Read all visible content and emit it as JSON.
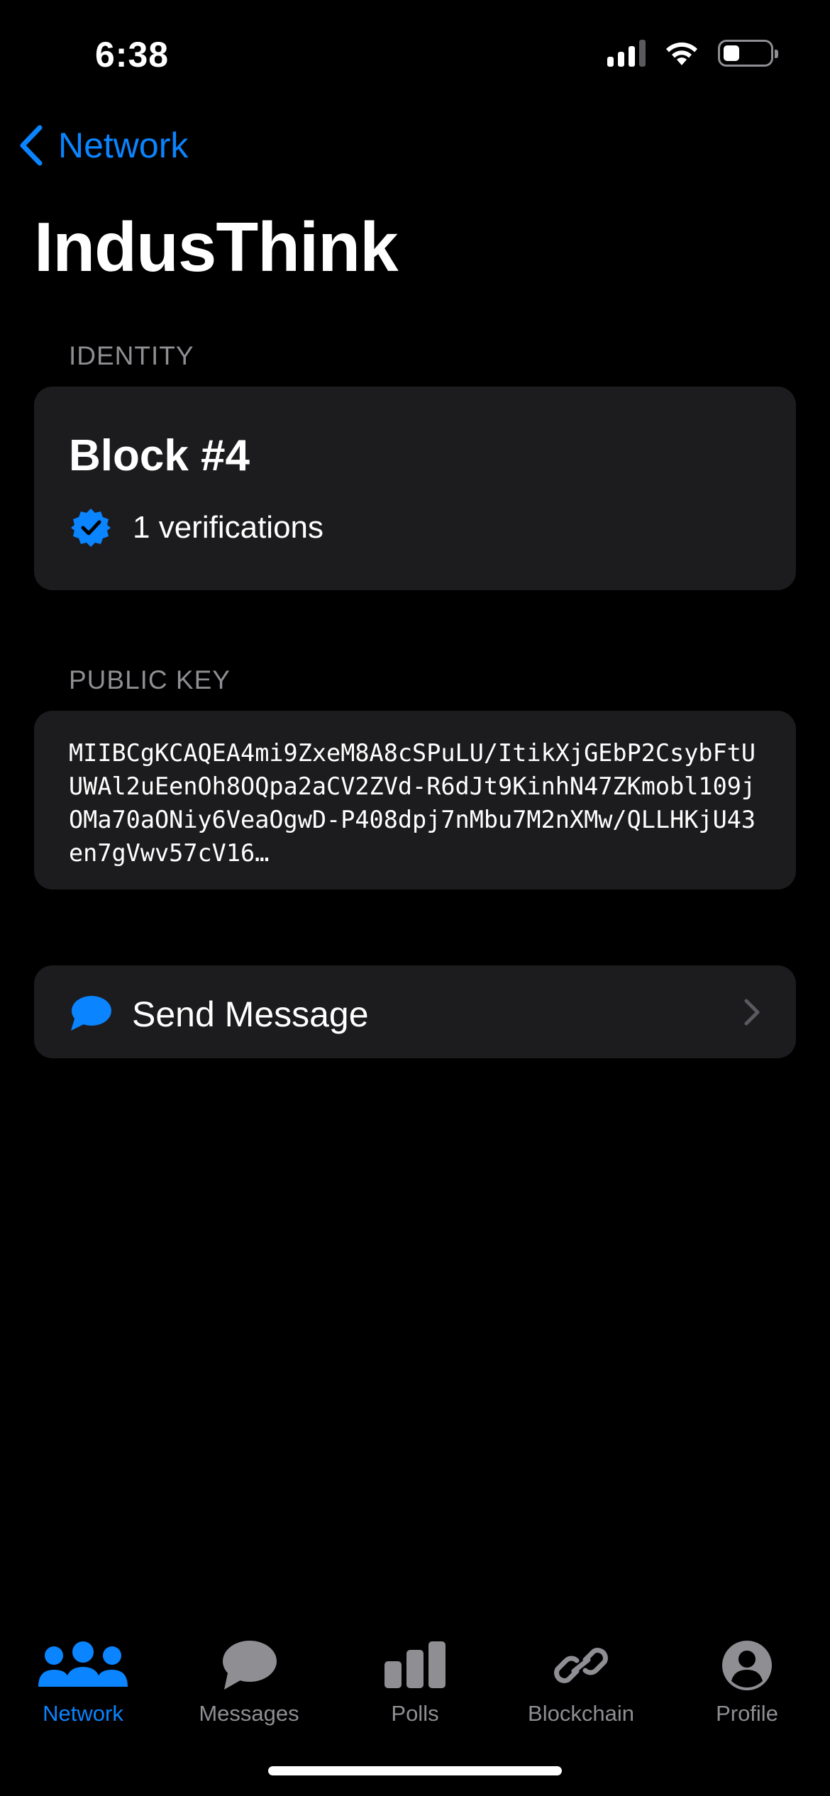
{
  "status_bar": {
    "time": "6:38",
    "icons": [
      "cellular-signal-icon",
      "wifi-icon",
      "battery-icon"
    ]
  },
  "nav": {
    "back_label": "Network",
    "title": "IndusThink"
  },
  "identity": {
    "section_label": "IDENTITY",
    "block_title": "Block #4",
    "verifications": "1 verifications",
    "verified_icon": "verified-badge-icon"
  },
  "public_key": {
    "section_label": "PUBLIC KEY",
    "value": "MIIBCgKCAQEA4mi9ZxeM8A8cSPuLU/ItikXjGEbP2CsybFtUUWAl2uEenOh8OQpa2aCV2ZVd-R6dJt9KinhN47ZKmobl109jOMa70aONiy6VeaOgwD-P408dpj7nMbu7M2nXMw/QLLHKjU43en7gVwv57cV16…"
  },
  "actions": {
    "send_message_label": "Send Message",
    "send_icon": "speech-bubble-icon"
  },
  "tab_bar": {
    "tabs": [
      {
        "label": "Network",
        "icon": "people-icon",
        "active": true
      },
      {
        "label": "Messages",
        "icon": "speech-bubble-icon",
        "active": false
      },
      {
        "label": "Polls",
        "icon": "bar-chart-icon",
        "active": false
      },
      {
        "label": "Blockchain",
        "icon": "link-icon",
        "active": false
      },
      {
        "label": "Profile",
        "icon": "person-circle-icon",
        "active": false
      }
    ]
  },
  "colors": {
    "accent": "#0a84ff",
    "background": "#000000",
    "card": "#1c1c1e",
    "secondary_text": "#8e8e93"
  }
}
